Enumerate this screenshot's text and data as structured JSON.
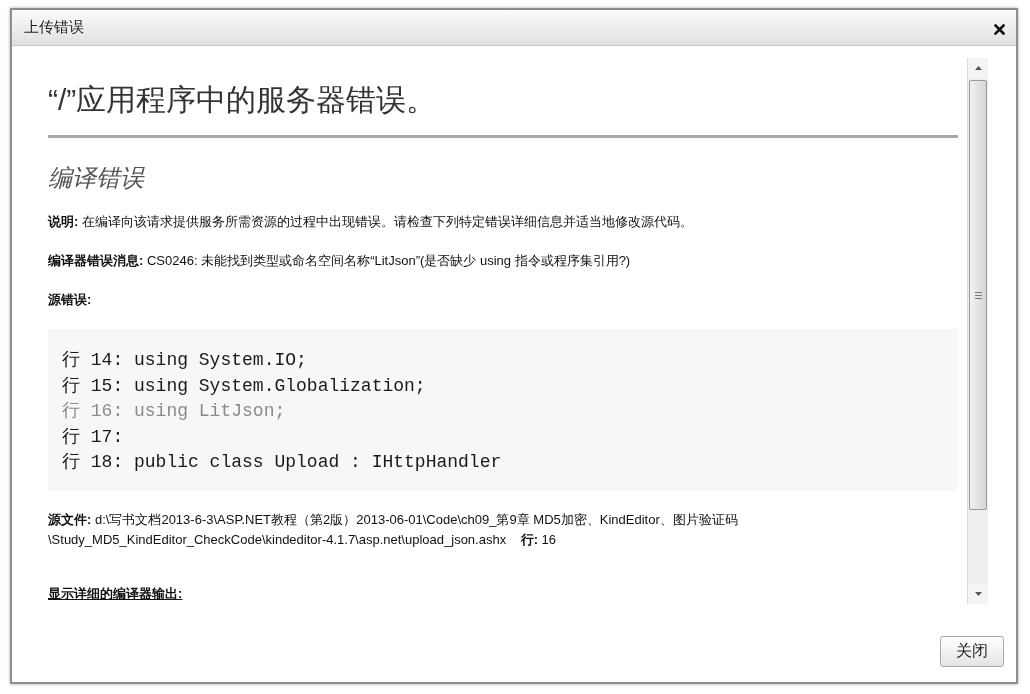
{
  "dialog": {
    "title": "上传错误",
    "content": {
      "heading": "“/”应用程序中的服务器错误。",
      "subheading": "编译错误",
      "details": [
        "**说明:** 在编译向该请求提供服务所需资源的过程中出现错误。请检查下列特定错误详细信息并适当地修改源代码。",
        "**编译器错误消息:** CS0246: 未能找到类型或命名空间名称“LitJson”(是否缺少 using 指令或程序集引用?)"
      ],
      "source_error_label": "源错误:",
      "source_lines": [
        {
          "text": "行 14: using System.IO;",
          "error": false
        },
        {
          "text": "行 15: using System.Globalization;",
          "error": false
        },
        {
          "text": "行 16: using LitJson;",
          "error": true
        },
        {
          "text": "行 17:",
          "error": false
        },
        {
          "text": "行 18: public class Upload : IHttpHandler",
          "error": false
        }
      ],
      "source_file": "**源文件:** d:\\写书文档2013-6-3\\ASP.NET教程（第2版）2013-06-01\\Code\\ch09_第9章 MD5加密、KindEditor、图片验证码\\Study_MD5_KindEditor_CheckCode\\kindeditor-4.1.7\\asp.net\\upload_json.ashx    **行:** 16",
      "compiler_output_link": "显示详细的编译器输出:"
    },
    "buttons": [
      "关闭"
    ]
  }
}
